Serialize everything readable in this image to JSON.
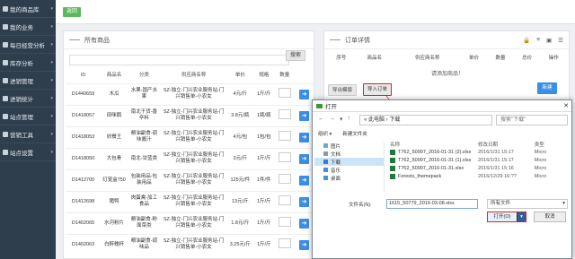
{
  "sidebar": {
    "items": [
      {
        "label": "我的商品库"
      },
      {
        "label": "我的业务"
      },
      {
        "label": "每日经营分析"
      },
      {
        "label": "库存分析"
      },
      {
        "label": "进销管理"
      },
      {
        "label": "进销统计"
      },
      {
        "label": "站点管理"
      },
      {
        "label": "营销工具"
      },
      {
        "label": "站点设置"
      }
    ]
  },
  "topbar": {
    "back_label": "返回"
  },
  "products": {
    "title": "所有商品",
    "search_button": "搜索",
    "columns": [
      "ID",
      "商品名",
      "分类",
      "供应商名称",
      "单价",
      "规格",
      "数量",
      ""
    ],
    "rows": [
      {
        "id": "D1440659",
        "name": "木瓜",
        "category": "水果-国产水果",
        "supplier": "SZ-独立-门兴农业服务站-门兴销售单-小农女",
        "price": "4元/斤",
        "spec": "1斤/斤"
      },
      {
        "id": "D1418057",
        "name": "田咪鹅",
        "category": "南北干货-香辛料",
        "supplier": "SZ-独立-门兴农业服务站-门兴销售单-小农女",
        "price": "3.8元/瓶",
        "spec": "1瓶/瓶"
      },
      {
        "id": "D1418053",
        "name": "欣餐王",
        "category": "粮油副食-调味酱汁",
        "supplier": "SZ-独立-门兴农业服务站-门兴销售单-小农女",
        "price": "4元/包",
        "spec": "1包/包"
      },
      {
        "id": "D1418050",
        "name": "大包骨",
        "category": "南北-甘蓝类",
        "supplier": "SZ-独立-门兴农业服务站-门兴销售单-小农女",
        "price": "3元/斤",
        "spec": "1斤/斤"
      },
      {
        "id": "D1412700",
        "name": "灯笼盒750",
        "category": "包装用品-包装用品",
        "supplier": "SZ-独立-门兴农业服务站-门兴销售单-小农女",
        "price": "125元/件",
        "spec": "1件/件"
      },
      {
        "id": "D1412698",
        "name": "猪鸭",
        "category": "肉蛋禽-加工食品",
        "supplier": "SZ-独立-门兴农业服务站-门兴销售单-小农女",
        "price": "13元/斤",
        "spec": "1斤/斤"
      },
      {
        "id": "D1402065",
        "name": "水河粉片",
        "category": "粮油副食-粉面菜类",
        "supplier": "SZ-独立-门兴农业服务站-门兴销售单-小农女",
        "price": "1.8元/斤",
        "spec": "1斤/斤"
      },
      {
        "id": "D1402063",
        "name": "白醉糯杯",
        "category": "粮油副食-调味品",
        "supplier": "SZ-独立-门兴农业服务站-门兴销售单-小农女",
        "price": "3.25元/斤",
        "spec": "1斤/斤"
      }
    ]
  },
  "orders": {
    "title": "订单详情",
    "columns": [
      "序号",
      "商品名",
      "供应商名称",
      "单价",
      "数量",
      "总价",
      "操作"
    ],
    "empty_text": "请添加商品！",
    "export_label": "导出模版",
    "import_label": "导入订单",
    "new_label": "新建"
  },
  "dialog": {
    "title": "打开",
    "address": "« 此电脑 › 下载",
    "search_placeholder": "搜索\"下载\"",
    "organize": "组织 ▾",
    "new_folder": "新建文件夹",
    "tree": [
      "图片",
      "文档",
      "下载",
      "音乐",
      "桌面"
    ],
    "col_name": "名称",
    "col_date": "修改日期",
    "col_type": "类型",
    "files": [
      {
        "name": "T762_50997_2016-01-31 (2).xlsx",
        "date": "2016/1/31 15:17",
        "type": "Micro"
      },
      {
        "name": "T762_50997_2016-01-31 (1).xlsx",
        "date": "2016/1/31 15:17",
        "type": "Micro"
      },
      {
        "name": "T762_50997_2016-01-31.xlsx",
        "date": "2016/1/31 15:16",
        "type": "Micro"
      },
      {
        "name": "Forests_themepack",
        "date": "2016/12/29 16:??",
        "type": "Micro"
      }
    ],
    "filename_label": "文件名(N):",
    "filename_value": "1615_50779_2016-03-08.xlsx",
    "filetype": "所有文件",
    "open_label": "打开(O)",
    "cancel_label": "取消"
  },
  "colors": {
    "accent": "#3a8ee6",
    "highlight": "#e02020",
    "sidebar": "#2f3e4d",
    "green": "#5cb85c"
  }
}
